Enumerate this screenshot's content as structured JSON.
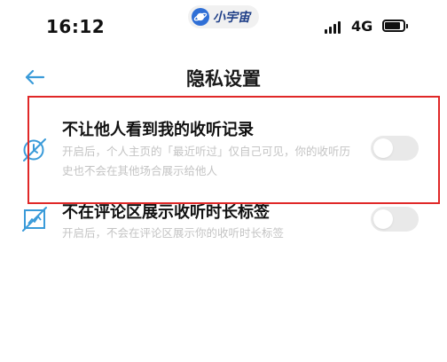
{
  "status_bar": {
    "time": "16:12",
    "app_name": "小宇宙",
    "network": "4G",
    "battery_level": 0.85
  },
  "header": {
    "back_icon": "arrow-left-icon",
    "title": "隐私设置"
  },
  "settings": [
    {
      "icon": "listening-history-icon",
      "title": "不让他人看到我的收听记录",
      "description": "开启后，个人主页的「最近听过」仅自己可见，你的收听历史也不会在其他场合展示给他人",
      "enabled": false
    },
    {
      "icon": "listening-duration-label-icon",
      "title": "不在评论区展示收听时长标签",
      "description": "开启后，不会在评论区展示你的收听时长标签",
      "enabled": false
    }
  ],
  "colors": {
    "accent": "#3a9bd9",
    "highlight_border": "#e02828",
    "toggle_off": "#e9e9e9",
    "description_text": "#c4c4c4"
  }
}
